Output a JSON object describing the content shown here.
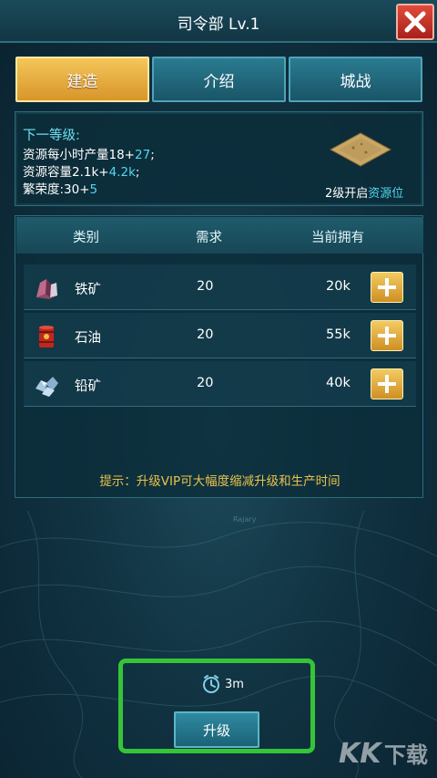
{
  "header": {
    "title": "司令部 Lv.1"
  },
  "tabs": [
    {
      "label": "建造",
      "active": true
    },
    {
      "label": "介绍",
      "active": false
    },
    {
      "label": "城战",
      "active": false
    }
  ],
  "next_level": {
    "heading": "下一等级:",
    "production_label": "资源每小时产量18+",
    "production_bonus": "27",
    "production_suffix": ";",
    "capacity_label": "资源容量2.1k+",
    "capacity_bonus": "4.2k",
    "capacity_suffix": ";",
    "prosperity_label": "繁荣度:30+",
    "prosperity_bonus": "5",
    "unlock_prefix": "2级开启",
    "unlock_highlight": "资源位"
  },
  "table": {
    "headers": {
      "category": "类别",
      "required": "需求",
      "owned": "当前拥有"
    },
    "rows": [
      {
        "icon": "iron-ore-icon",
        "name": "铁矿",
        "required": "20",
        "owned": "20k"
      },
      {
        "icon": "oil-barrel-icon",
        "name": "石油",
        "required": "20",
        "owned": "55k"
      },
      {
        "icon": "lead-ore-icon",
        "name": "铅矿",
        "required": "20",
        "owned": "40k"
      }
    ]
  },
  "tip": "提示：升级VIP可大幅度缩减升级和生产时间",
  "map_label": "Rajary",
  "upgrade": {
    "time": "3m",
    "button_label": "升级"
  },
  "watermark": "KK下载",
  "colors": {
    "active_tab": "#e3a93c",
    "inactive_tab": "#22687c",
    "cyan_text": "#50d8f0",
    "tip_text": "#e8c24a",
    "highlight_frame": "#35c437",
    "close_button": "#c9352a"
  }
}
